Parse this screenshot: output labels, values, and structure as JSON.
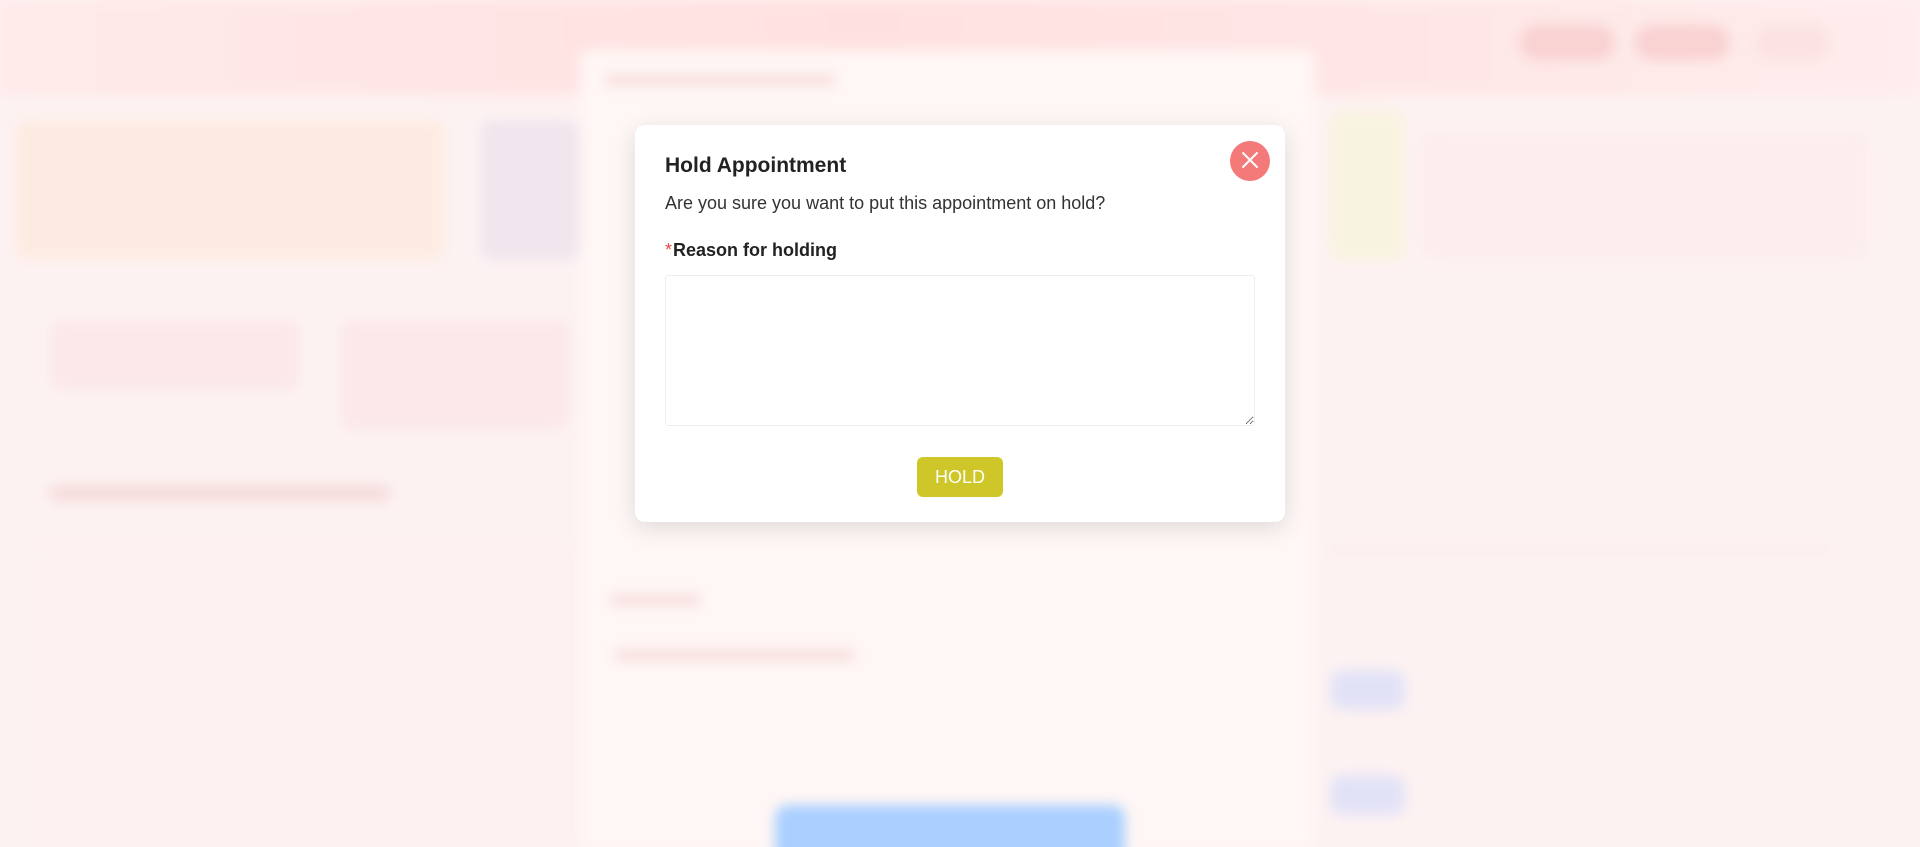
{
  "modal": {
    "title": "Hold Appointment",
    "message": "Are you sure you want to put this appointment on hold?",
    "field_label": "Reason for holding",
    "required_marker": "*",
    "textarea_value": "",
    "hold_label": "HOLD",
    "close_icon": "close-icon"
  },
  "colors": {
    "close_button": "#f47a7a",
    "hold_button": "#cfc72a",
    "required": "#e24a4a",
    "backdrop_accent": "#ffd6d6",
    "background_primary_button": "#8ec0ff"
  }
}
